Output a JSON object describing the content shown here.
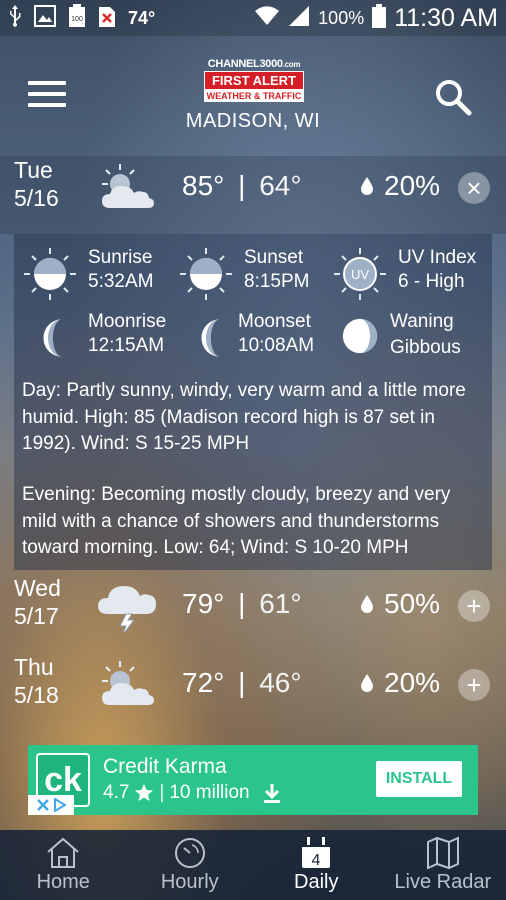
{
  "status_bar": {
    "temperature": "74°",
    "battery": "100%",
    "time": "11:30 AM",
    "notification_badge": "100"
  },
  "header": {
    "logo_channel": "CHANNEL3000",
    "logo_channel_suffix": ".com",
    "logo_first_alert": "FIRST ALERT",
    "logo_subtitle": "WEATHER & TRAFFIC",
    "location": "MADISON, WI"
  },
  "days": [
    {
      "name": "Tue",
      "date": "5/16",
      "icon": "partly-sunny-icon",
      "high": "85°",
      "separator": "|",
      "low": "64°",
      "precip": "20%",
      "button": "×"
    },
    {
      "name": "Wed",
      "date": "5/17",
      "icon": "thunderstorm-icon",
      "high": "79°",
      "separator": "|",
      "low": "61°",
      "precip": "50%",
      "button": "+"
    },
    {
      "name": "Thu",
      "date": "5/18",
      "icon": "partly-sunny-icon",
      "high": "72°",
      "separator": "|",
      "low": "46°",
      "precip": "20%",
      "button": "+"
    }
  ],
  "detail": {
    "sunrise_label": "Sunrise",
    "sunrise_value": "5:32AM",
    "sunset_label": "Sunset",
    "sunset_value": "8:15PM",
    "uv_label": "UV Index",
    "uv_value": "6 - High",
    "uv_icon_text": "UV",
    "moonrise_label": "Moonrise",
    "moonrise_value": "12:15AM",
    "moonset_label": "Moonset",
    "moonset_value": "10:08AM",
    "moonphase_line1": "Waning",
    "moonphase_line2": "Gibbous",
    "day_text": "Day: Partly sunny, windy, very warm and a little more humid. High: 85 (Madison record high is 87 set in 1992). Wind: S 15-25 MPH",
    "evening_text": "Evening: Becoming mostly cloudy, breezy and very mild with a chance of showers and thunderstorms toward morning. Low: 64; Wind: S 10-20 MPH"
  },
  "ad": {
    "logo_text": "ck",
    "title": "Credit Karma",
    "rating": "4.7",
    "installs": "10 million",
    "install_label": "INSTALL",
    "color": "#2bc58c"
  },
  "nav": {
    "items": [
      {
        "label": "Home",
        "active": false
      },
      {
        "label": "Hourly",
        "active": false
      },
      {
        "label": "Daily",
        "active": true,
        "badge": "4"
      },
      {
        "label": "Live Radar",
        "active": false
      }
    ]
  }
}
